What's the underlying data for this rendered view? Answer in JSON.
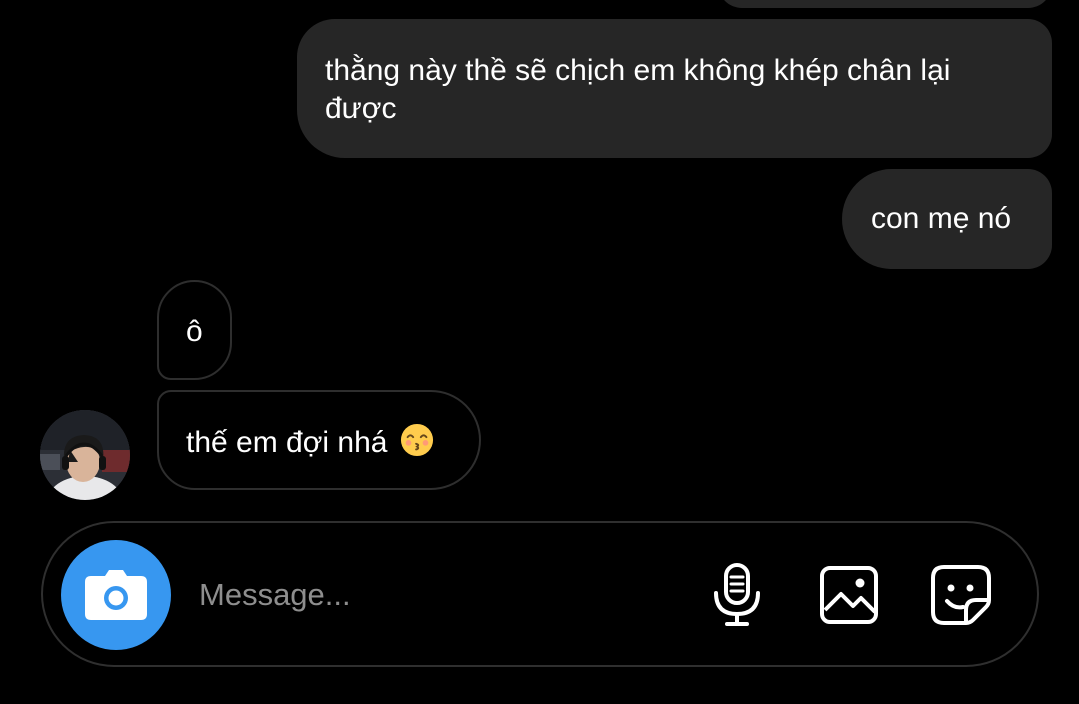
{
  "conversation": {
    "messages": [
      {
        "direction": "sent",
        "text": "thằng này thề sẽ chịch em không khép chân lại được"
      },
      {
        "direction": "sent",
        "text": "con mẹ nó"
      },
      {
        "direction": "received",
        "text": "ô"
      },
      {
        "direction": "received",
        "text": "thế em đợi nhá",
        "emoji": "kissing-face-with-smiling-eyes"
      }
    ]
  },
  "composer": {
    "placeholder": "Message...",
    "value": "",
    "buttons": {
      "camera": "camera-icon",
      "voice": "microphone-icon",
      "gallery": "image-icon",
      "sticker": "sticker-icon"
    }
  },
  "colors": {
    "background": "#000000",
    "sent_bubble": "#262626",
    "received_bubble_border": "#2e2e2e",
    "camera_button": "#3797f0",
    "placeholder": "#8e8e8e"
  }
}
